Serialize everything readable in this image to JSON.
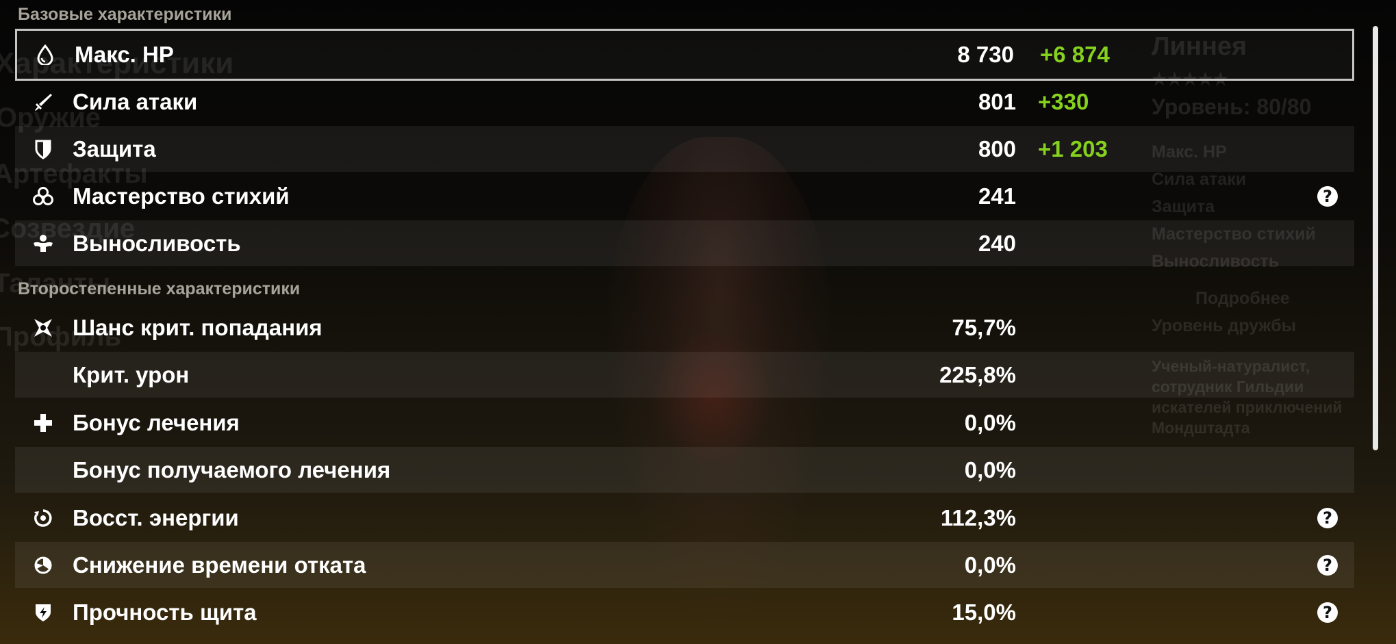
{
  "background": {
    "page_title": "Характеристики",
    "menu": [
      "Оружие",
      "Артефакты",
      "Созвездие",
      "Таланты",
      "Профиль"
    ],
    "character": {
      "name": "Линнея",
      "stars": "★★★★★",
      "level_label": "Уровень: 80/80",
      "stats": [
        "Макс. HP",
        "Сила атаки",
        "Защита",
        "Мастерство стихий",
        "Выносливость"
      ],
      "details_button": "Подробнее",
      "friendship": "Уровень дружбы",
      "description": [
        "Ученый-натуралист,",
        "сотрудник Гильдии",
        "искателей приключений",
        "Мондштадта"
      ]
    }
  },
  "sections": {
    "base_title": "Базовые характеристики",
    "secondary_title": "Второстепенные характеристики"
  },
  "base_stats": [
    {
      "label": "Макс. HP",
      "value": "8 730",
      "bonus": "+6 874",
      "icon": "hp-drop-icon"
    },
    {
      "label": "Сила атаки",
      "value": "801",
      "bonus": "+330",
      "icon": "sword-icon"
    },
    {
      "label": "Защита",
      "value": "800",
      "bonus": "+1 203",
      "icon": "shield-icon"
    },
    {
      "label": "Мастерство стихий",
      "value": "241",
      "bonus": "",
      "icon": "elemental-mastery-icon",
      "help": true
    },
    {
      "label": "Выносливость",
      "value": "240",
      "bonus": "",
      "icon": "stamina-icon"
    }
  ],
  "secondary_stats": [
    {
      "label": "Шанс крит. попадания",
      "value": "75,7%",
      "icon": "crit-icon"
    },
    {
      "label": "Крит. урон",
      "value": "225,8%",
      "icon": ""
    },
    {
      "label": "Бонус лечения",
      "value": "0,0%",
      "icon": "healing-cross-icon"
    },
    {
      "label": "Бонус получаемого лечения",
      "value": "0,0%",
      "icon": ""
    },
    {
      "label": "Восст. энергии",
      "value": "112,3%",
      "icon": "energy-recharge-icon",
      "help": true
    },
    {
      "label": "Снижение времени отката",
      "value": "0,0%",
      "icon": "cooldown-icon",
      "help": true
    },
    {
      "label": "Прочность щита",
      "value": "15,0%",
      "icon": "shield-strength-icon",
      "help": true
    }
  ],
  "help_glyph": "?",
  "colors": {
    "bonus": "#86d11e",
    "section_title": "#a7a39a",
    "text": "#ffffff"
  }
}
